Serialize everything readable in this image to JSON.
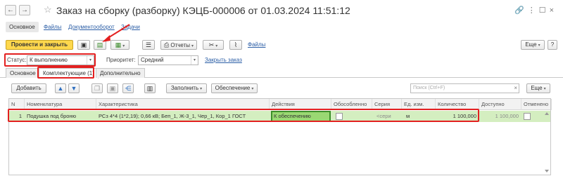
{
  "window": {
    "title": "Заказ на сборку (разборку) КЭЦБ-000006 от 01.03.2024 11:51:12",
    "back_icon": "←",
    "forward_icon": "→",
    "star_icon": "☆",
    "link_icon": "🔗",
    "more_icon": "⋮",
    "maximize_icon": "☐",
    "close_icon": "×"
  },
  "nav": {
    "tabs": [
      {
        "label": "Основное"
      },
      {
        "label": "Файлы"
      },
      {
        "label": "Документооборот"
      },
      {
        "label": "Задачи"
      }
    ]
  },
  "toolbar": {
    "post_close_label": "Провести и закрыть",
    "reports_label": "Отчеты",
    "files_label": "Файлы",
    "more_label": "Еще",
    "help_label": "?"
  },
  "status": {
    "label": "Статус:",
    "value": "К выполнению",
    "priority_label": "Приоритет:",
    "priority_value": "Средний",
    "close_order_link": "Закрыть заказ"
  },
  "subtabs": [
    {
      "label": "Основное"
    },
    {
      "label": "Комплектующие (1)"
    },
    {
      "label": "Дополнительно"
    }
  ],
  "table_toolbar": {
    "add_label": "Добавить",
    "fill_label": "Заполнить",
    "provision_label": "Обеспечение",
    "search_placeholder": "Поиск (Ctrl+F)",
    "more_label": "Еще"
  },
  "table": {
    "columns": [
      "N",
      "Номенклатура",
      "Характеристика",
      "Действия",
      "Обособленно",
      "Серия",
      "Ед. изм.",
      "Количество",
      "Доступно",
      "Отменено"
    ],
    "rows": [
      {
        "n": "1",
        "item": "Подушка под броню",
        "characteristic": "РСз 4*4 (1*2,19); 0,66 кВ; Беп_1, Ж-3_1, Чер_1, Кор_1 ГОСТ",
        "action": "К обеспечению",
        "series": "<сери",
        "unit": "м",
        "quantity": "1 100,000",
        "available": "1 100,000"
      }
    ]
  },
  "colors": {
    "accent_primary": "#ffd84d",
    "highlight_row": "#d4eec0",
    "highlight_border": "#e32020",
    "action_cell": "#9ad873"
  }
}
